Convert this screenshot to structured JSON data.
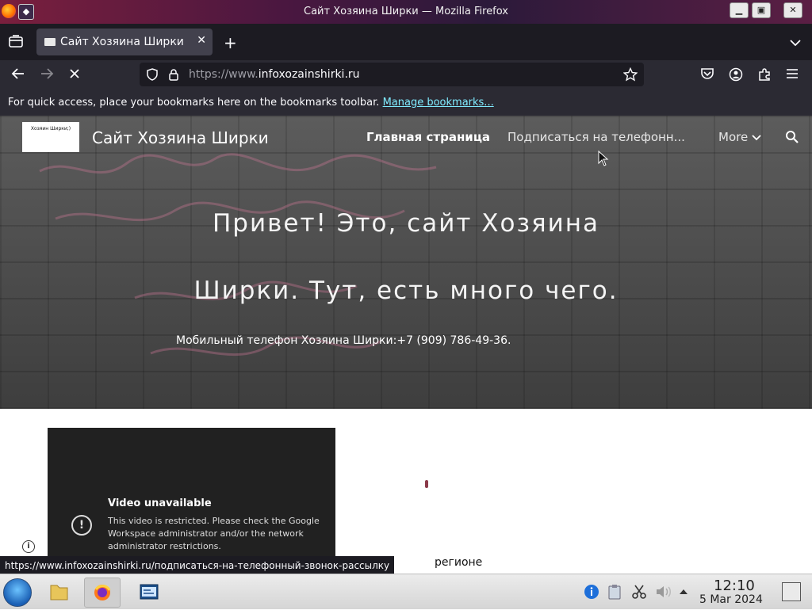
{
  "window": {
    "title": "Сайт Хозяина Ширки — Mozilla Firefox",
    "controls": [
      "minimize",
      "maximize",
      "close"
    ]
  },
  "browser": {
    "tab_title": "Сайт Хозяина Ширки",
    "url_prefix": "https://www.",
    "url_host": "infoxozainshirki.ru",
    "bookmarks_hint": "For quick access, place your bookmarks here on the bookmarks toolbar.",
    "bookmarks_link": "Manage bookmarks...",
    "status_link": "https://www.infoxozainshirki.ru/подписаться-на-телефонный-звонок-рассылку"
  },
  "site": {
    "logo_text": "Хозяин Ширки;)",
    "title": "Сайт Хозяина Ширки",
    "nav": {
      "home": "Главная страница",
      "subscribe": "Подписаться на телефонн...",
      "more": "More"
    },
    "hero_line1": "Привет! Это, сайт Хозяина",
    "hero_line2": "Ширки. Тут, есть много чего.",
    "phone": "Мобильный телефон Хозяина Ширки:+7 (909) 786-49-36.",
    "video": {
      "title": "Video unavailable",
      "message": "This video is restricted. Please check the Google Workspace administrator and/or the network administrator restrictions."
    },
    "region_fragment": "регионе"
  },
  "taskbar": {
    "time": "12:10",
    "date": "5 Mar 2024"
  }
}
